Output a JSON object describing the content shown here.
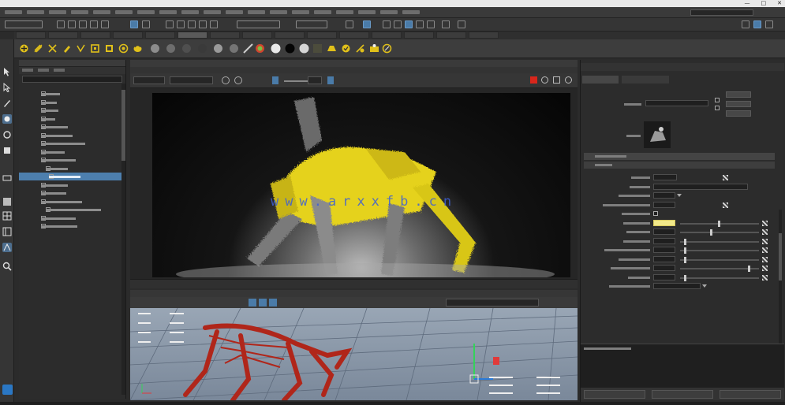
{
  "window": {
    "title": "",
    "controls": [
      "—",
      "□",
      "✕"
    ]
  },
  "watermark": {
    "text": "www.arxxfb.cn"
  },
  "viewport": {
    "frame_field": ""
  },
  "attribute_editor": {
    "name_label": "",
    "name_value": "",
    "focus_button": "",
    "presets_button": "",
    "show_button": "",
    "section_1": "",
    "section_2": "",
    "fields": [
      "",
      "",
      "",
      "",
      "",
      "",
      "",
      "",
      "",
      "",
      "",
      "",
      ""
    ],
    "footer_buttons": [
      "",
      "",
      ""
    ]
  },
  "colors": {
    "selection_blue": "#4d7fae",
    "robot_yellow": "#e5d21a",
    "skeleton_red": "#b0261a",
    "highlight_field": "#f2e98a",
    "maya_blue": "#2a77c4"
  },
  "icons": [
    "select-tool-icon",
    "lasso-tool-icon",
    "paint-tool-icon",
    "move-tool-icon",
    "rotate-tool-icon",
    "scale-tool-icon",
    "sphere-icon",
    "cube-icon",
    "render-icon",
    "camera-icon",
    "magnifier-icon"
  ]
}
